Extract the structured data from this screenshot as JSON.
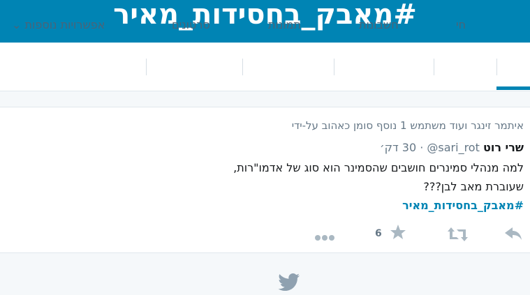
{
  "header": {
    "hashtag_title": "#מאבק_בחסידות_מאיר"
  },
  "nav": {
    "tabs": [
      {
        "label": "מ",
        "active": true
      },
      {
        "label": "חי",
        "active": false
      },
      {
        "label": "חשבונות",
        "active": false
      },
      {
        "label": "תמונות",
        "active": false
      },
      {
        "label": "סרטונים",
        "active": false
      },
      {
        "label": "אפשרויות נוספות ⌄",
        "active": false
      }
    ]
  },
  "tweet": {
    "context": "איתמר זינגר ועוד משתמש 1 נוסף סומן כאהוב על-ידי",
    "author_name": "שרי רוט",
    "author_handle": "@sari_rot",
    "separator": "·",
    "time": "30 דק׳",
    "body_line1": "למה מנהלי סמינרים חושבים שהסמינר הוא סוג של אדמו\"רות,",
    "body_line2": "שעוברת מאב לבן???",
    "hashtag": "#מאבק_בחסידות_מאיר",
    "like_count": "6"
  },
  "icons": {
    "reply": "reply-icon",
    "retweet": "retweet-icon",
    "like": "star-icon",
    "more": "more-icon",
    "footer": "twitter-bird-icon"
  },
  "colors": {
    "brand": "#0084b4",
    "muted": "#657786",
    "icon": "#aab8c2"
  }
}
